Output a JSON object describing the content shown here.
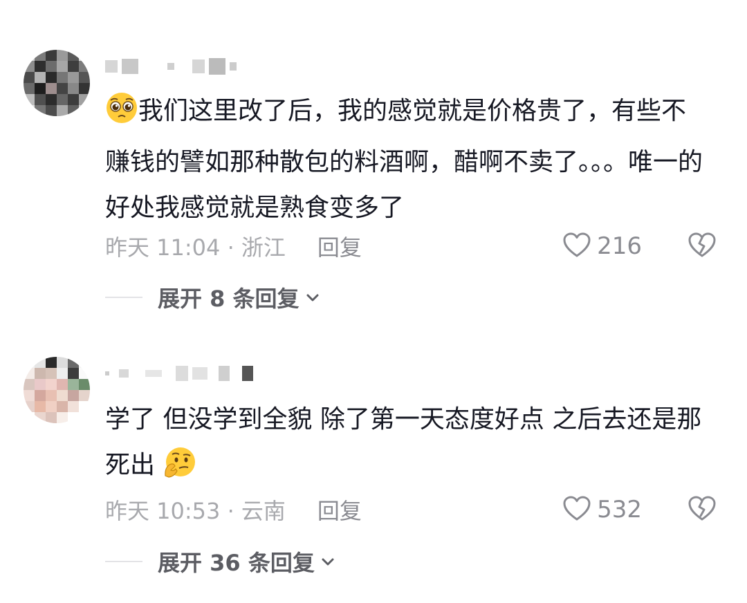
{
  "comments": [
    {
      "text_before": "",
      "text_after": "我们这里改了后，我的感觉就是价格贵了，有些不赚钱的譬如那种散包的料酒啊，醋啊不卖了。。。唯一的好处我感觉就是熟食变多了",
      "emoji": "pleading-face-emoji",
      "time_location": "昨天 11:04 · 浙江",
      "reply_label": "回复",
      "likes": "216",
      "expand_label": "展开 8 条回复"
    },
    {
      "text_before": "学了  但没学到全貌  除了第一天态度好点  之后去还是那死出",
      "text_after": "",
      "emoji": "thinking-face-emoji",
      "time_location": "昨天 10:53 · 云南",
      "reply_label": "回复",
      "likes": "532",
      "expand_label": "展开 36 条回复"
    }
  ],
  "colors": {
    "text": "#161823",
    "meta": "#a8a9ad",
    "icon": "#8a8b91",
    "expand": "#5c5d63"
  }
}
